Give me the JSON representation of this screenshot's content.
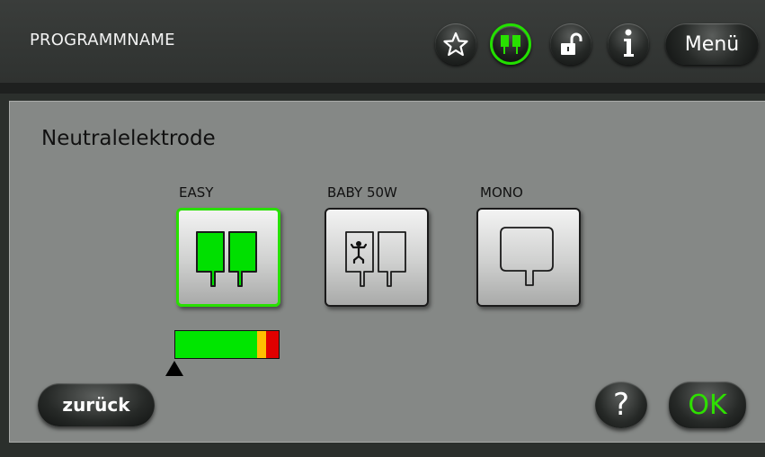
{
  "header": {
    "program_name": "PROGRAMMNAME",
    "buttons": [
      {
        "icon": "star-outline-icon"
      },
      {
        "icon": "neutral-electrode-icon",
        "active": true
      },
      {
        "icon": "unlock-icon"
      },
      {
        "icon": "info-icon"
      }
    ],
    "menu_label": "Menü"
  },
  "main": {
    "title": "Neutralelektrode",
    "options": [
      {
        "label": "EASY",
        "icon": "split-electrode-icon",
        "selected": true
      },
      {
        "label": "BABY 50W",
        "icon": "baby-split-electrode-icon",
        "selected": false
      },
      {
        "label": "MONO",
        "icon": "mono-electrode-icon",
        "selected": false
      }
    ],
    "quality_indicator": {
      "segments": [
        {
          "color": "#00e600",
          "fraction": 0.79
        },
        {
          "color": "#ffc000",
          "fraction": 0.09
        },
        {
          "color": "#e00000",
          "fraction": 0.12
        }
      ],
      "marker_position": 0.0
    }
  },
  "footer": {
    "back_label": "zurück",
    "help_label": "?",
    "ok_label": "OK"
  },
  "colors": {
    "accent_green": "#28e000",
    "panel_gray": "#858886",
    "header_dark": "#2f3230"
  }
}
